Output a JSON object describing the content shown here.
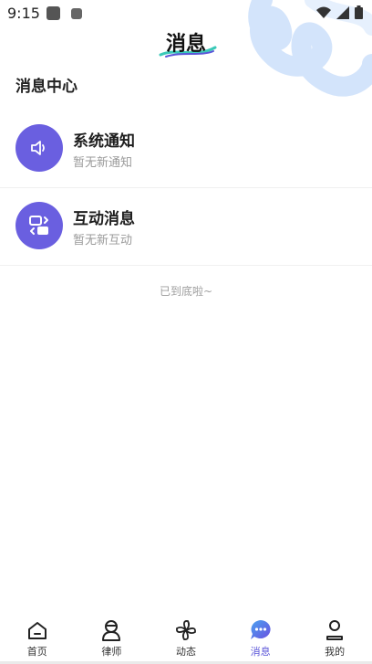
{
  "status_bar": {
    "time": "9:15"
  },
  "header": {
    "title": "消息"
  },
  "section": {
    "title": "消息中心"
  },
  "messages": [
    {
      "title": "系统通知",
      "subtitle": "暂无新通知",
      "icon": "speaker-icon"
    },
    {
      "title": "互动消息",
      "subtitle": "暂无新互动",
      "icon": "interact-icon"
    }
  ],
  "list_end_text": "已到底啦~",
  "bottom_nav": {
    "items": [
      {
        "label": "首页",
        "icon": "home-icon",
        "active": false
      },
      {
        "label": "律师",
        "icon": "lawyer-icon",
        "active": false
      },
      {
        "label": "动态",
        "icon": "pinwheel-icon",
        "active": false
      },
      {
        "label": "消息",
        "icon": "chat-bubble-icon",
        "active": true
      },
      {
        "label": "我的",
        "icon": "user-icon",
        "active": false
      }
    ]
  },
  "colors": {
    "accent": "#6a5fe0",
    "active_nav": "#5b56d8",
    "deco": "#cfe3fb"
  }
}
